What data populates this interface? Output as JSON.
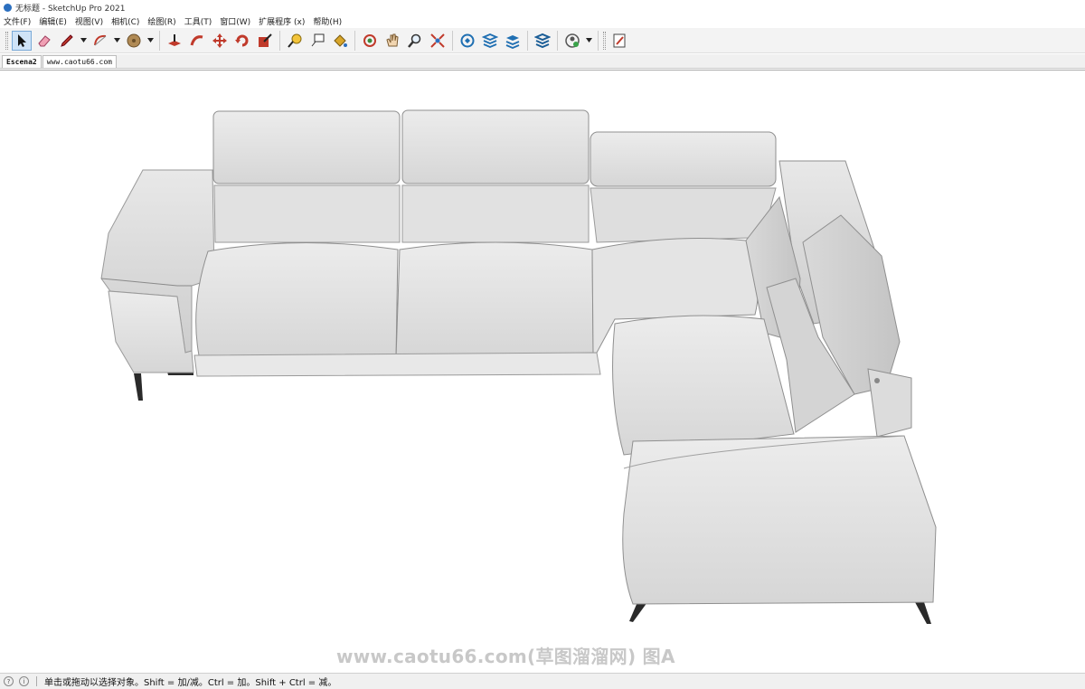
{
  "window": {
    "title": "无标题 - SketchUp Pro 2021"
  },
  "menu": [
    "文件(F)",
    "编辑(E)",
    "视图(V)",
    "相机(C)",
    "绘图(R)",
    "工具(T)",
    "窗口(W)",
    "扩展程序 (x)",
    "帮助(H)"
  ],
  "scene_tabs": {
    "scene": "Escena2",
    "url_tab": "www.caotu66.com"
  },
  "watermark": "www.caotu66.com(草图溜溜网) 图A",
  "status": {
    "message": "单击或拖动以选择对象。Shift = 加/减。Ctrl = 加。Shift + Ctrl = 减。"
  },
  "colors": {
    "accent": "#cfe3f7",
    "sofa": "#e3e3e3",
    "sofa_shade": "#cfcfcf",
    "legs": "#2a2a2a"
  }
}
